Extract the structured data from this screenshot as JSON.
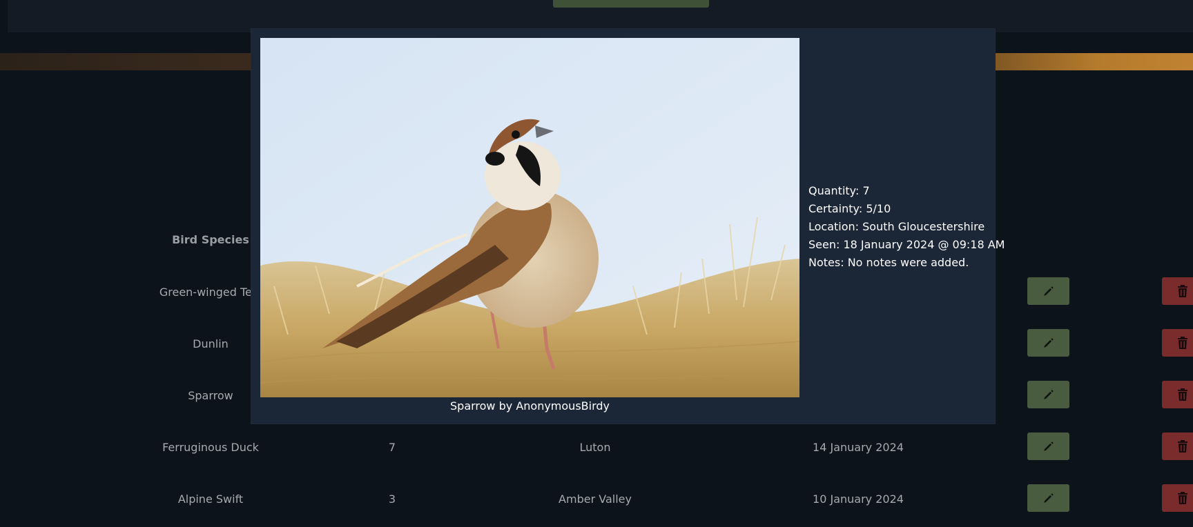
{
  "table": {
    "header_species": "Bird Species",
    "rows": [
      {
        "species": "Green-winged Teal",
        "quantity": "",
        "location": "",
        "date": ""
      },
      {
        "species": "Dunlin",
        "quantity": "",
        "location": "",
        "date": ""
      },
      {
        "species": "Sparrow",
        "quantity": "",
        "location": "",
        "date": ""
      },
      {
        "species": "Ferruginous Duck",
        "quantity": "7",
        "location": "Luton",
        "date": "14 January 2024"
      },
      {
        "species": "Alpine Swift",
        "quantity": "3",
        "location": "Amber Valley",
        "date": "10 January 2024"
      }
    ]
  },
  "modal": {
    "caption": "Sparrow by AnonymousBirdy",
    "quantity": "Quantity: 7",
    "certainty": "Certainty: 5/10",
    "location": "Location: South Gloucestershire",
    "seen": "Seen: 18 January 2024 @ 09:18 AM",
    "notes": "Notes: No notes were added."
  },
  "icons": {
    "edit": "pencil-icon",
    "delete": "trash-icon"
  },
  "colors": {
    "background": "#0d131b",
    "modal": "#1b2637",
    "edit_button": "#4a5c3f",
    "delete_button": "#7a2c2c"
  }
}
